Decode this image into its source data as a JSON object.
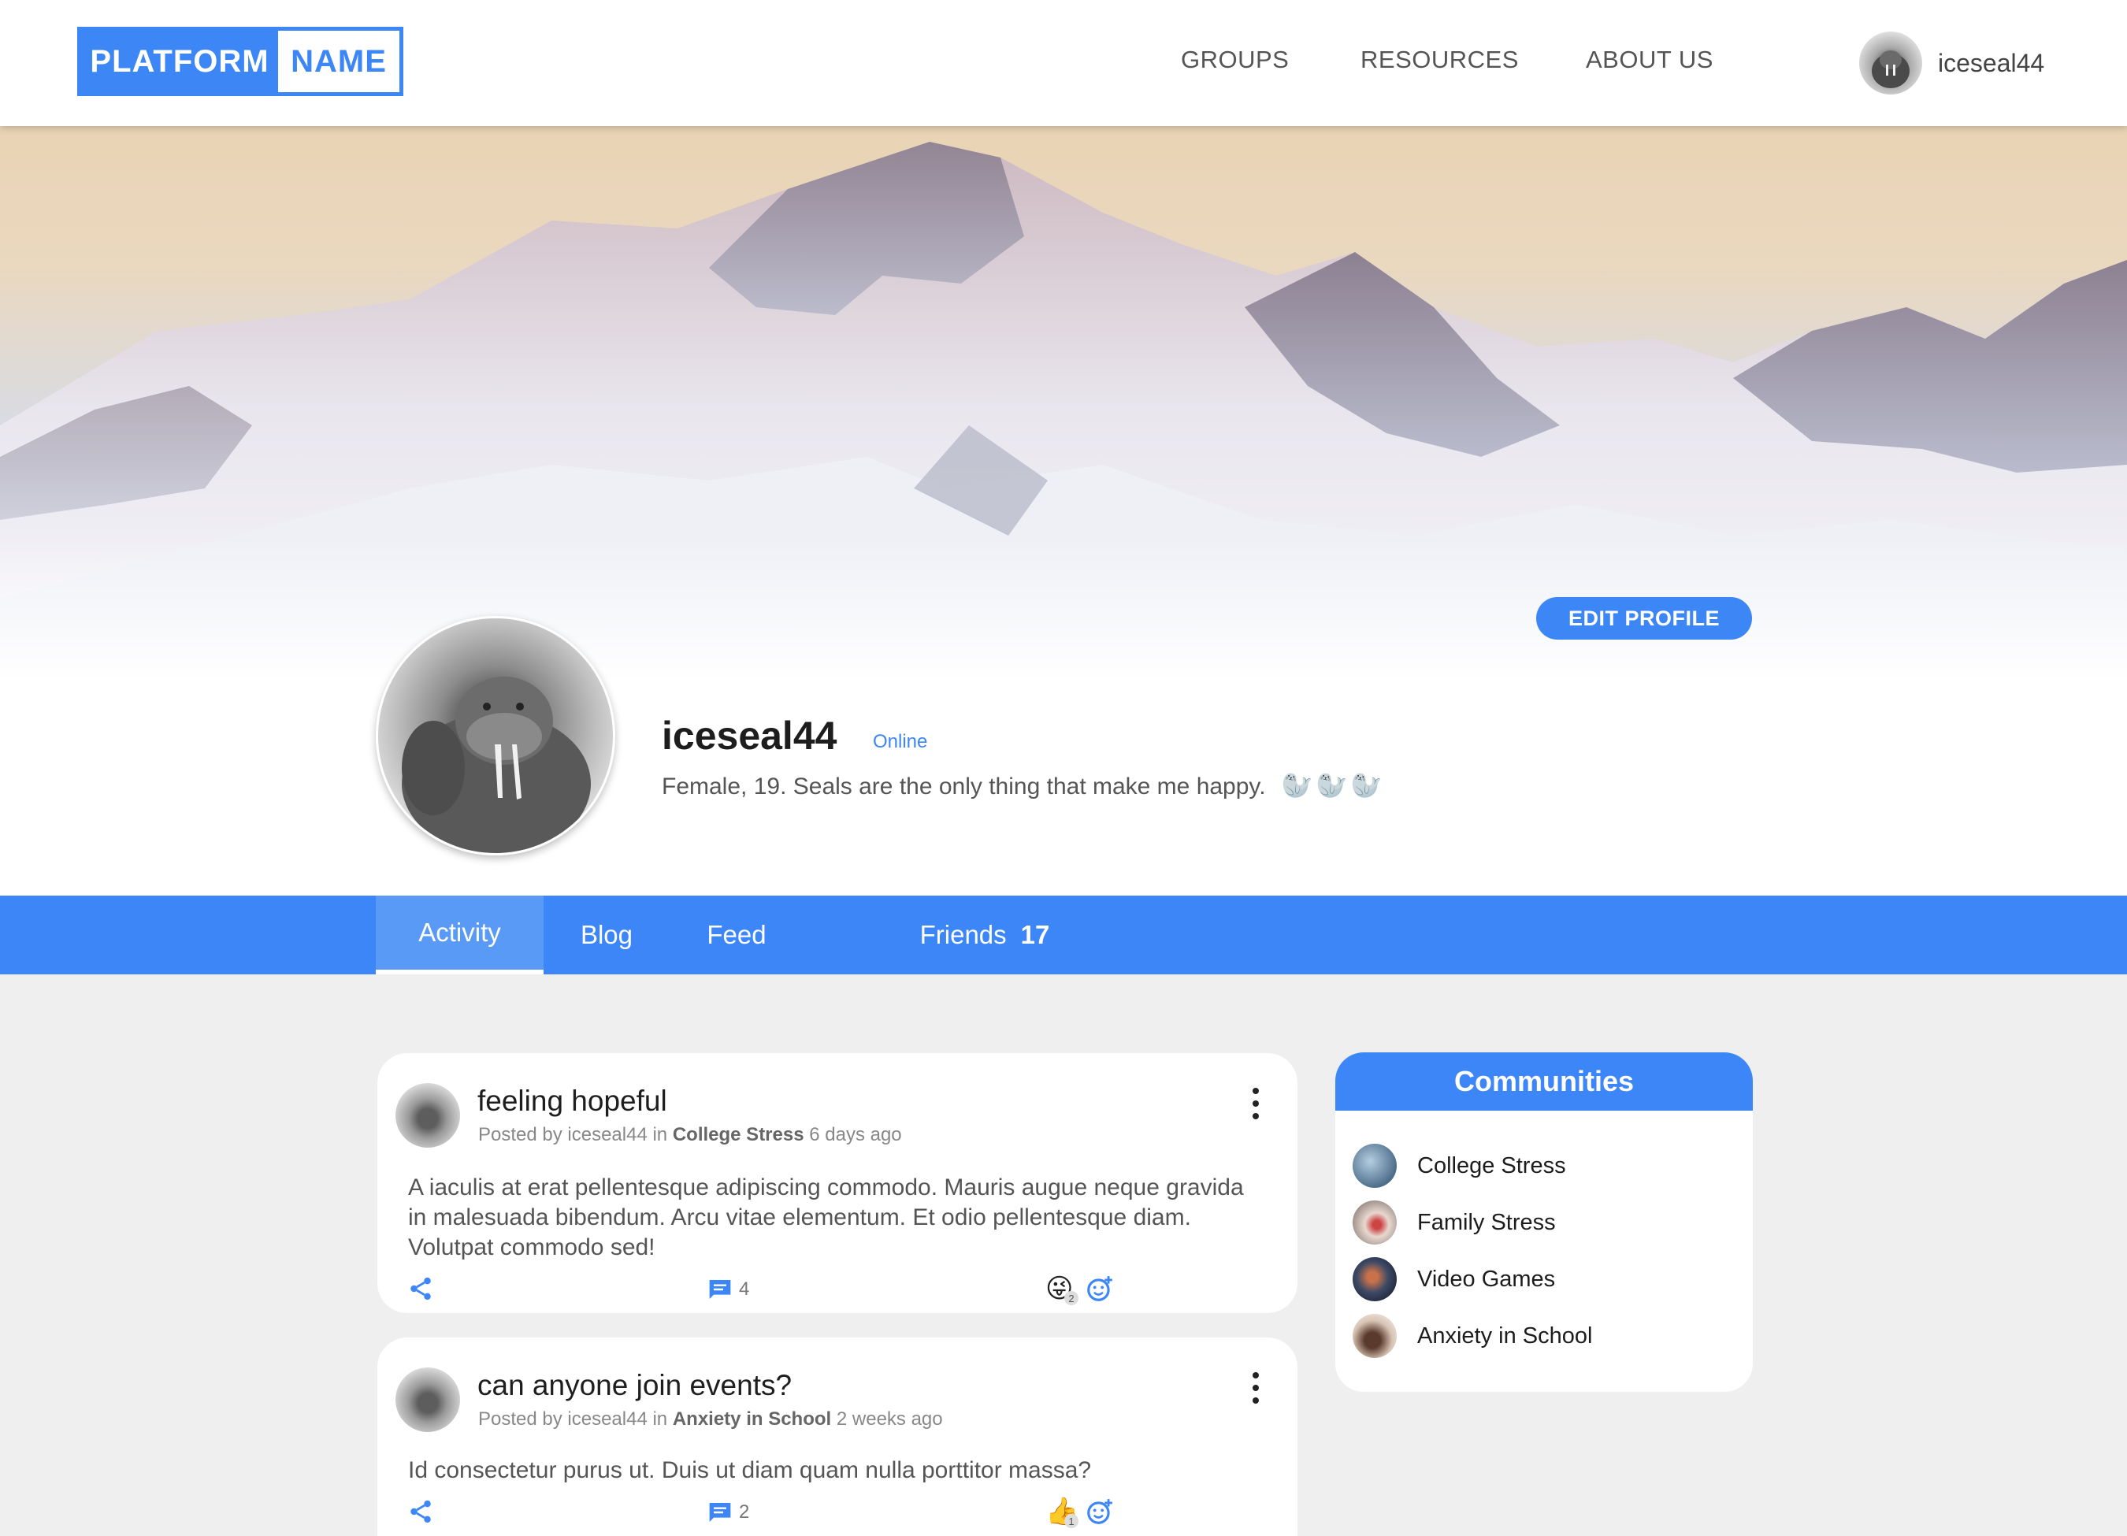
{
  "header": {
    "logo_part1": "PLATFORM",
    "logo_part2": "NAME",
    "nav": [
      "GROUPS",
      "RESOURCES",
      "ABOUT US"
    ],
    "username": "iceseal44"
  },
  "hero": {
    "edit_button": "EDIT PROFILE"
  },
  "profile": {
    "name": "iceseal44",
    "status": "Online",
    "bio": "Female, 19. Seals are the only thing that make me happy.",
    "bio_icons": "🦭🦭🦭"
  },
  "tabs": {
    "activity": "Activity",
    "blog": "Blog",
    "feed": "Feed",
    "friends": "Friends",
    "friends_count": "17"
  },
  "posts": [
    {
      "title": "feeling hopeful",
      "meta_prefix": "Posted by iceseal44 in ",
      "group": "College Stress",
      "time": "6 days ago",
      "body": "A iaculis at erat pellentesque adipiscing commodo. Mauris augue neque gravida in malesuada bibendum. Arcu vitae elementum. Et odio pellentesque diam. Volutpat commodo sed!",
      "comments": "4",
      "reaction": "😜",
      "reaction_count": "2"
    },
    {
      "title": "can anyone join events?",
      "meta_prefix": "Posted by iceseal44 in ",
      "group": "Anxiety in School",
      "time": "2 weeks ago",
      "body": "Id consectetur purus ut. Duis ut diam quam nulla porttitor massa?",
      "comments": "2",
      "reaction": "👍",
      "reaction_count": "1"
    }
  ],
  "communities": {
    "title": "Communities",
    "items": [
      "College Stress",
      "Family Stress",
      "Video Games",
      "Anxiety in School"
    ]
  },
  "colors": {
    "accent": "#3d86f7",
    "tab_active": "#5a9af7",
    "background": "#efefef"
  }
}
